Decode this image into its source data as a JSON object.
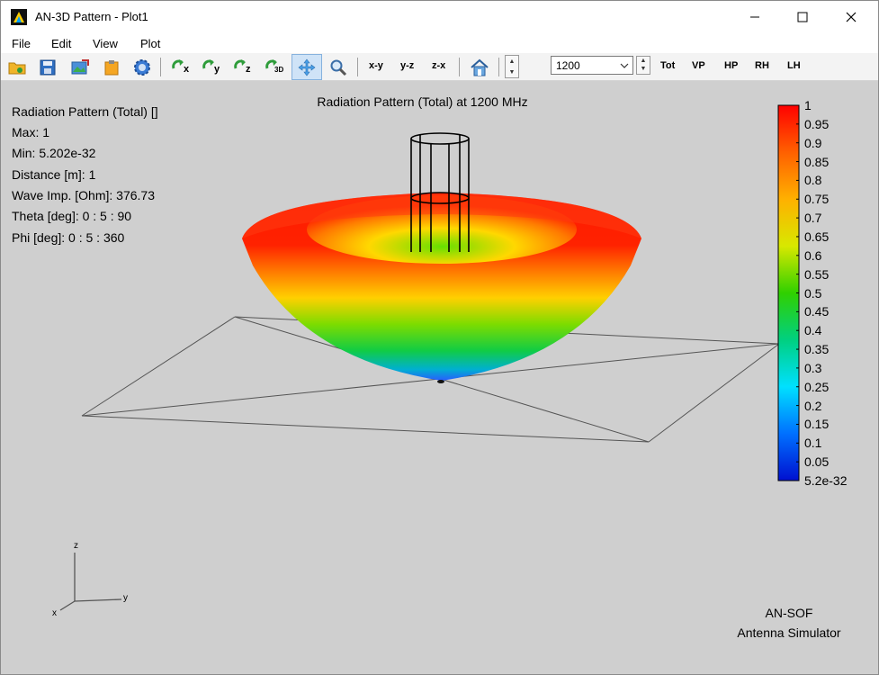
{
  "window": {
    "title": "AN-3D Pattern - Plot1"
  },
  "menu": [
    "File",
    "Edit",
    "View",
    "Plot"
  ],
  "toolbar": {
    "icons": [
      "open-folder-icon",
      "save-icon",
      "export-image-icon",
      "clipboard-icon",
      "settings-gear-icon",
      "rotate-x-icon",
      "rotate-y-icon",
      "rotate-z-icon",
      "rotate-3d-icon",
      "pan-icon",
      "zoom-icon",
      "home-icon"
    ],
    "rotate_labels": {
      "x": "x",
      "y": "y",
      "z": "z",
      "three_d": "3D"
    },
    "view_labels": {
      "xy": "x-y",
      "yz": "y-z",
      "zx": "z-x"
    },
    "frequency_value": "1200",
    "pattern_buttons": [
      "Tot",
      "VP",
      "HP",
      "RH",
      "LH"
    ]
  },
  "plot": {
    "title": "Radiation Pattern (Total) at 1200 MHz",
    "info": [
      "Radiation Pattern (Total) []",
      "Max: 1",
      "Min: 5.202e-32",
      "Distance [m]: 1",
      "Wave Imp. [Ohm]: 376.73",
      "Theta [deg]: 0 : 5 : 90",
      "Phi [deg]: 0 : 5 : 360"
    ],
    "colorbar_labels": [
      "1",
      "0.95",
      "0.9",
      "0.85",
      "0.8",
      "0.75",
      "0.7",
      "0.65",
      "0.6",
      "0.55",
      "0.5",
      "0.45",
      "0.4",
      "0.35",
      "0.3",
      "0.25",
      "0.2",
      "0.15",
      "0.1",
      "0.05",
      "5.2e-32"
    ],
    "axes": {
      "z": "z",
      "y": "y",
      "x": "x"
    },
    "brand_line1": "AN-SOF",
    "brand_line2": "Antenna Simulator"
  }
}
